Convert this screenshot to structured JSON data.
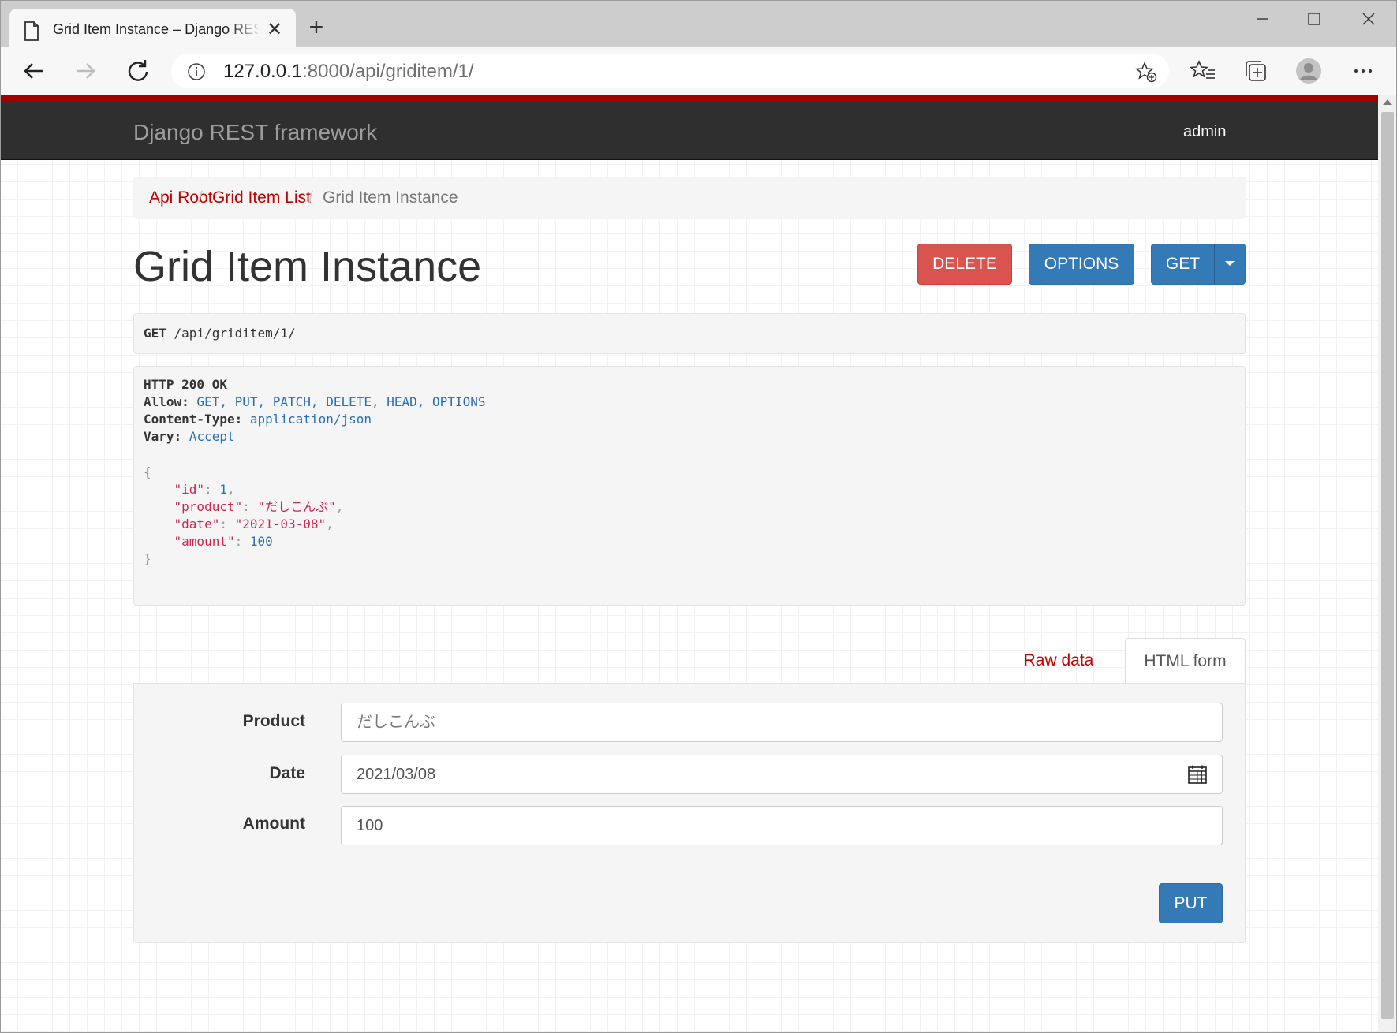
{
  "browser": {
    "tab_title": "Grid Item Instance – Django REST framework",
    "tab_close": "✕",
    "new_tab": "+",
    "url_host": "127.0.0.1",
    "url_rest": ":8000/api/griditem/1/",
    "icons": [
      "page-icon",
      "back-icon",
      "forward-icon",
      "reload-icon",
      "info-icon",
      "add-favorite-icon",
      "favorites-icon",
      "collections-icon",
      "profile-icon",
      "more-icon",
      "minimize-icon",
      "maximize-icon",
      "close-icon"
    ]
  },
  "navbar": {
    "brand": "Django REST framework",
    "user": "admin"
  },
  "breadcrumb": {
    "items": [
      {
        "label": "Api Root"
      },
      {
        "label": "Grid Item List"
      },
      {
        "label": "Grid Item Instance"
      }
    ],
    "separator": "/"
  },
  "page": {
    "title": "Grid Item Instance"
  },
  "actions": {
    "delete": "DELETE",
    "options": "OPTIONS",
    "get": "GET"
  },
  "request": {
    "method": "GET",
    "path": " /api/griditem/1/"
  },
  "response": {
    "status": "HTTP 200 OK",
    "headers": [
      {
        "key": "Allow:",
        "value": " GET, PUT, PATCH, DELETE, HEAD, OPTIONS"
      },
      {
        "key": "Content-Type:",
        "value": " application/json"
      },
      {
        "key": "Vary:",
        "value": " Accept"
      }
    ],
    "json": {
      "open": "{",
      "close": "}",
      "fields": [
        {
          "key": "\"id\"",
          "value": "1",
          "type": "number",
          "comma": ","
        },
        {
          "key": "\"product\"",
          "value": "\"だしこんぶ\"",
          "type": "string",
          "comma": ","
        },
        {
          "key": "\"date\"",
          "value": "\"2021-03-08\"",
          "type": "string",
          "comma": ","
        },
        {
          "key": "\"amount\"",
          "value": "100",
          "type": "number",
          "comma": ""
        }
      ]
    }
  },
  "form_tabs": {
    "raw": "Raw data",
    "html": "HTML form",
    "active": "HTML form"
  },
  "form": {
    "fields": [
      {
        "label": "Product",
        "value": "",
        "placeholder": "だしこんぶ"
      },
      {
        "label": "Date",
        "value": "2021/03/08",
        "placeholder": ""
      },
      {
        "label": "Amount",
        "value": "100",
        "placeholder": ""
      }
    ],
    "submit": "PUT"
  },
  "colors": {
    "accent_red": "#c20000",
    "navbar_bg": "#2f2f2f",
    "btn_primary": "#337ab7",
    "btn_danger": "#d9534f"
  }
}
